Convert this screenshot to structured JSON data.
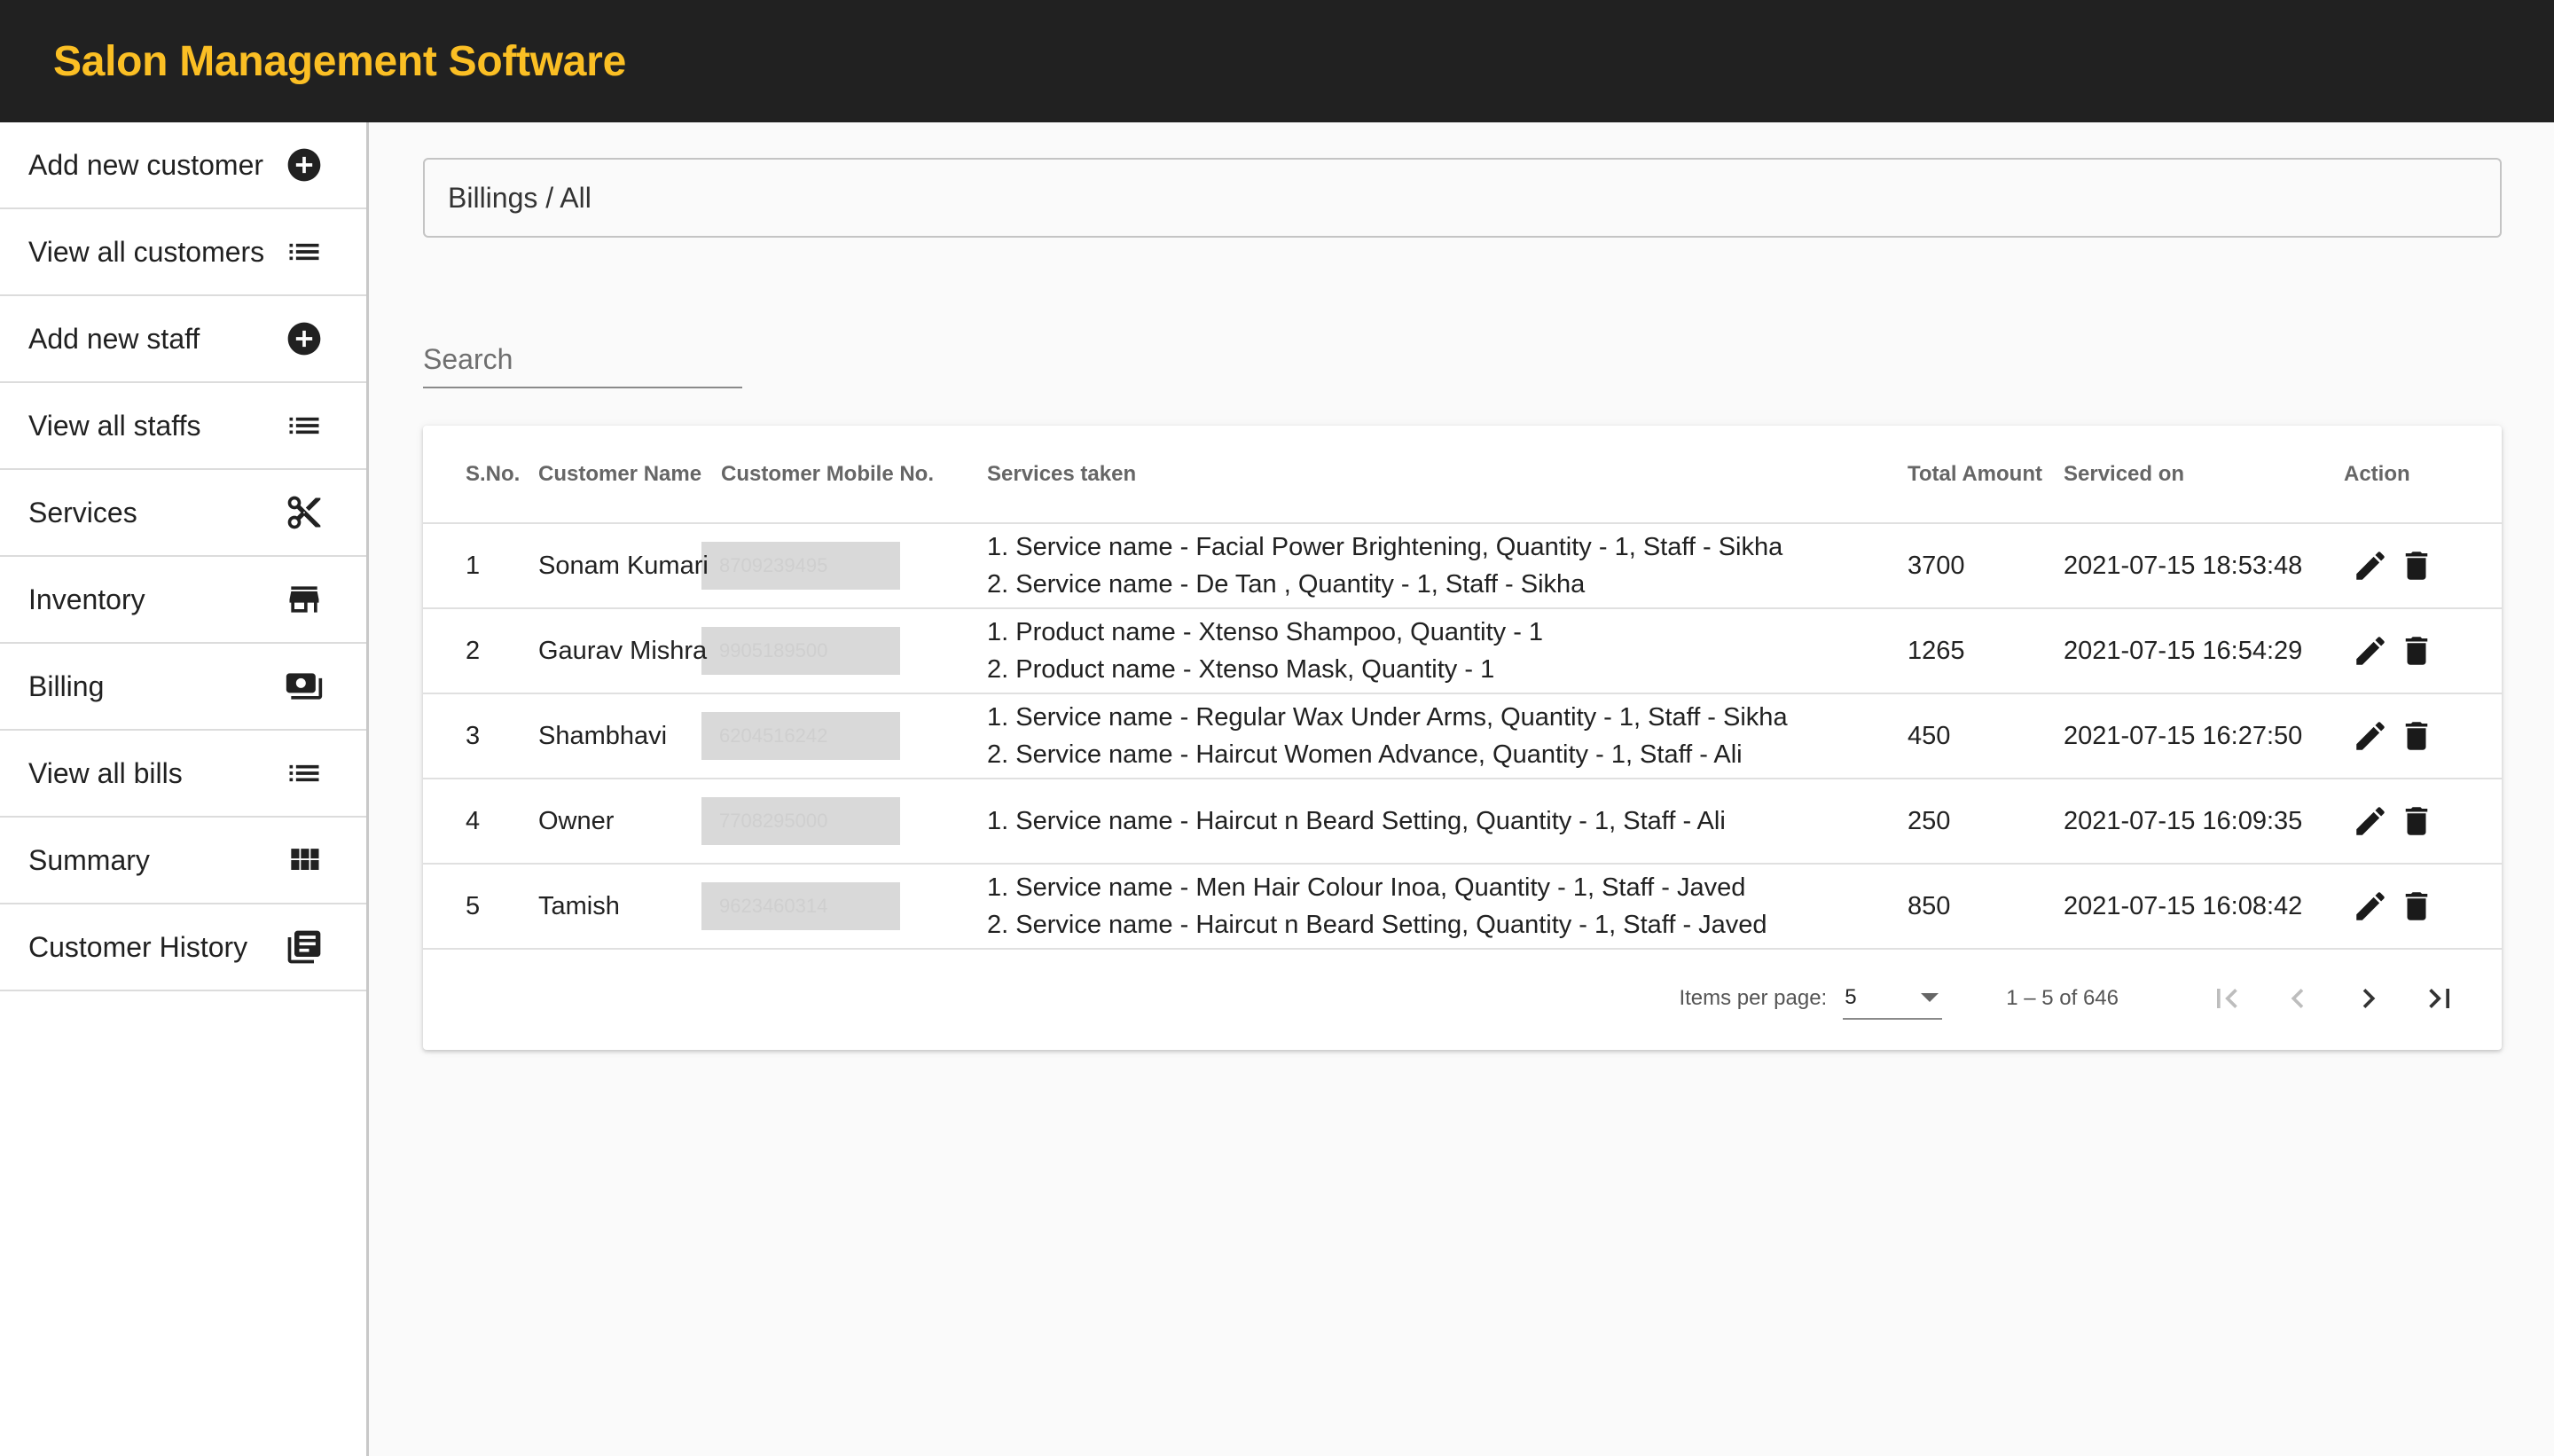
{
  "app": {
    "title": "Salon Management Software"
  },
  "sidebar": {
    "items": [
      {
        "label": "Add new customer",
        "icon": "add-circle-icon"
      },
      {
        "label": "View all customers",
        "icon": "list-icon"
      },
      {
        "label": "Add new staff",
        "icon": "add-circle-icon"
      },
      {
        "label": "View all staffs",
        "icon": "list-icon"
      },
      {
        "label": "Services",
        "icon": "scissors-icon"
      },
      {
        "label": "Inventory",
        "icon": "store-icon"
      },
      {
        "label": "Billing",
        "icon": "money-icon"
      },
      {
        "label": "View all bills",
        "icon": "list-icon"
      },
      {
        "label": "Summary",
        "icon": "grid-icon"
      },
      {
        "label": "Customer History",
        "icon": "library-books-icon"
      }
    ]
  },
  "breadcrumb": {
    "text": "Billings / All"
  },
  "search": {
    "placeholder": "Search",
    "value": ""
  },
  "table": {
    "headers": {
      "sno": "S.No.",
      "name": "Customer Name",
      "mobile": "Customer Mobile No.",
      "services": "Services taken",
      "amount": "Total Amount",
      "date": "Serviced on",
      "action": "Action"
    },
    "rows": [
      {
        "sno": "1",
        "name": "Sonam Kumari",
        "mobile": "8709239495",
        "services": [
          "1. Service name - Facial Power Brightening, Quantity - 1, Staff - Sikha",
          "2. Service name - De Tan , Quantity - 1, Staff - Sikha"
        ],
        "amount": "3700",
        "date": "2021-07-15 18:53:48"
      },
      {
        "sno": "2",
        "name": "Gaurav Mishra",
        "mobile": "9905189500",
        "services": [
          "1. Product name - Xtenso Shampoo, Quantity - 1",
          "2. Product name - Xtenso Mask, Quantity - 1"
        ],
        "amount": "1265",
        "date": "2021-07-15 16:54:29"
      },
      {
        "sno": "3",
        "name": "Shambhavi",
        "mobile": "6204516242",
        "services": [
          "1. Service name - Regular Wax Under Arms, Quantity - 1, Staff - Sikha",
          "2. Service name - Haircut Women Advance, Quantity - 1, Staff - Ali"
        ],
        "amount": "450",
        "date": "2021-07-15 16:27:50"
      },
      {
        "sno": "4",
        "name": "Owner",
        "mobile": "7708295000",
        "services": [
          "1. Service name - Haircut n Beard Setting, Quantity - 1, Staff - Ali"
        ],
        "amount": "250",
        "date": "2021-07-15 16:09:35"
      },
      {
        "sno": "5",
        "name": "Tamish",
        "mobile": "9623460314",
        "services": [
          "1. Service name - Men Hair Colour Inoa, Quantity - 1, Staff - Javed",
          "2. Service name - Haircut n Beard Setting, Quantity - 1, Staff - Javed"
        ],
        "amount": "850",
        "date": "2021-07-15 16:08:42"
      }
    ]
  },
  "paginator": {
    "items_per_page_label": "Items per page:",
    "items_per_page": "5",
    "range_label": "1 – 5 of 646"
  },
  "colors": {
    "topbar": "#212121",
    "brand": "#fbbf24"
  }
}
